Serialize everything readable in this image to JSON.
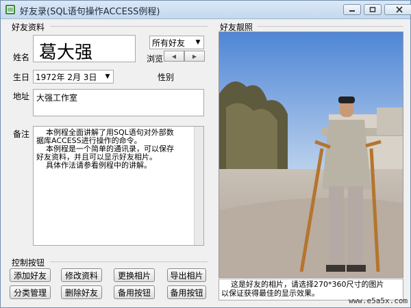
{
  "window": {
    "title": "好友录(SQL语句操作ACCESS例程)"
  },
  "info_group": {
    "title": "好友资料",
    "name_label": "姓名",
    "name_value": "葛大强",
    "filter_value": "所有好友",
    "browse_label": "浏览",
    "birthday_label": "生日",
    "birthday_value": "1972年 2月 3日",
    "gender_label": "性别",
    "address_label": "地址",
    "address_value": "大强工作室",
    "notes_label": "备注",
    "notes_lines": [
      "    本例程全面讲解了用SQL语句对外部数",
      "据库ACCESS进行操作的命令。",
      "    本例程是一个简单的通讯录，可以保存",
      "好友资料，并且可以显示好友相片。",
      "    具体作法请参看例程中的讲解。"
    ]
  },
  "photo_group": {
    "title": "好友靓照",
    "caption_line1": "    这是好友的相片，请选择270*360尺寸的图片",
    "caption_line2": "以保证获得最佳的显示效果。"
  },
  "control_group": {
    "title": "控制按钮",
    "buttons": [
      "添加好友",
      "修改资料",
      "更换相片",
      "导出相片",
      "分类管理",
      "删除好友",
      "备用按钮",
      "备用按钮"
    ]
  },
  "watermark": "www.e5a5x.com"
}
